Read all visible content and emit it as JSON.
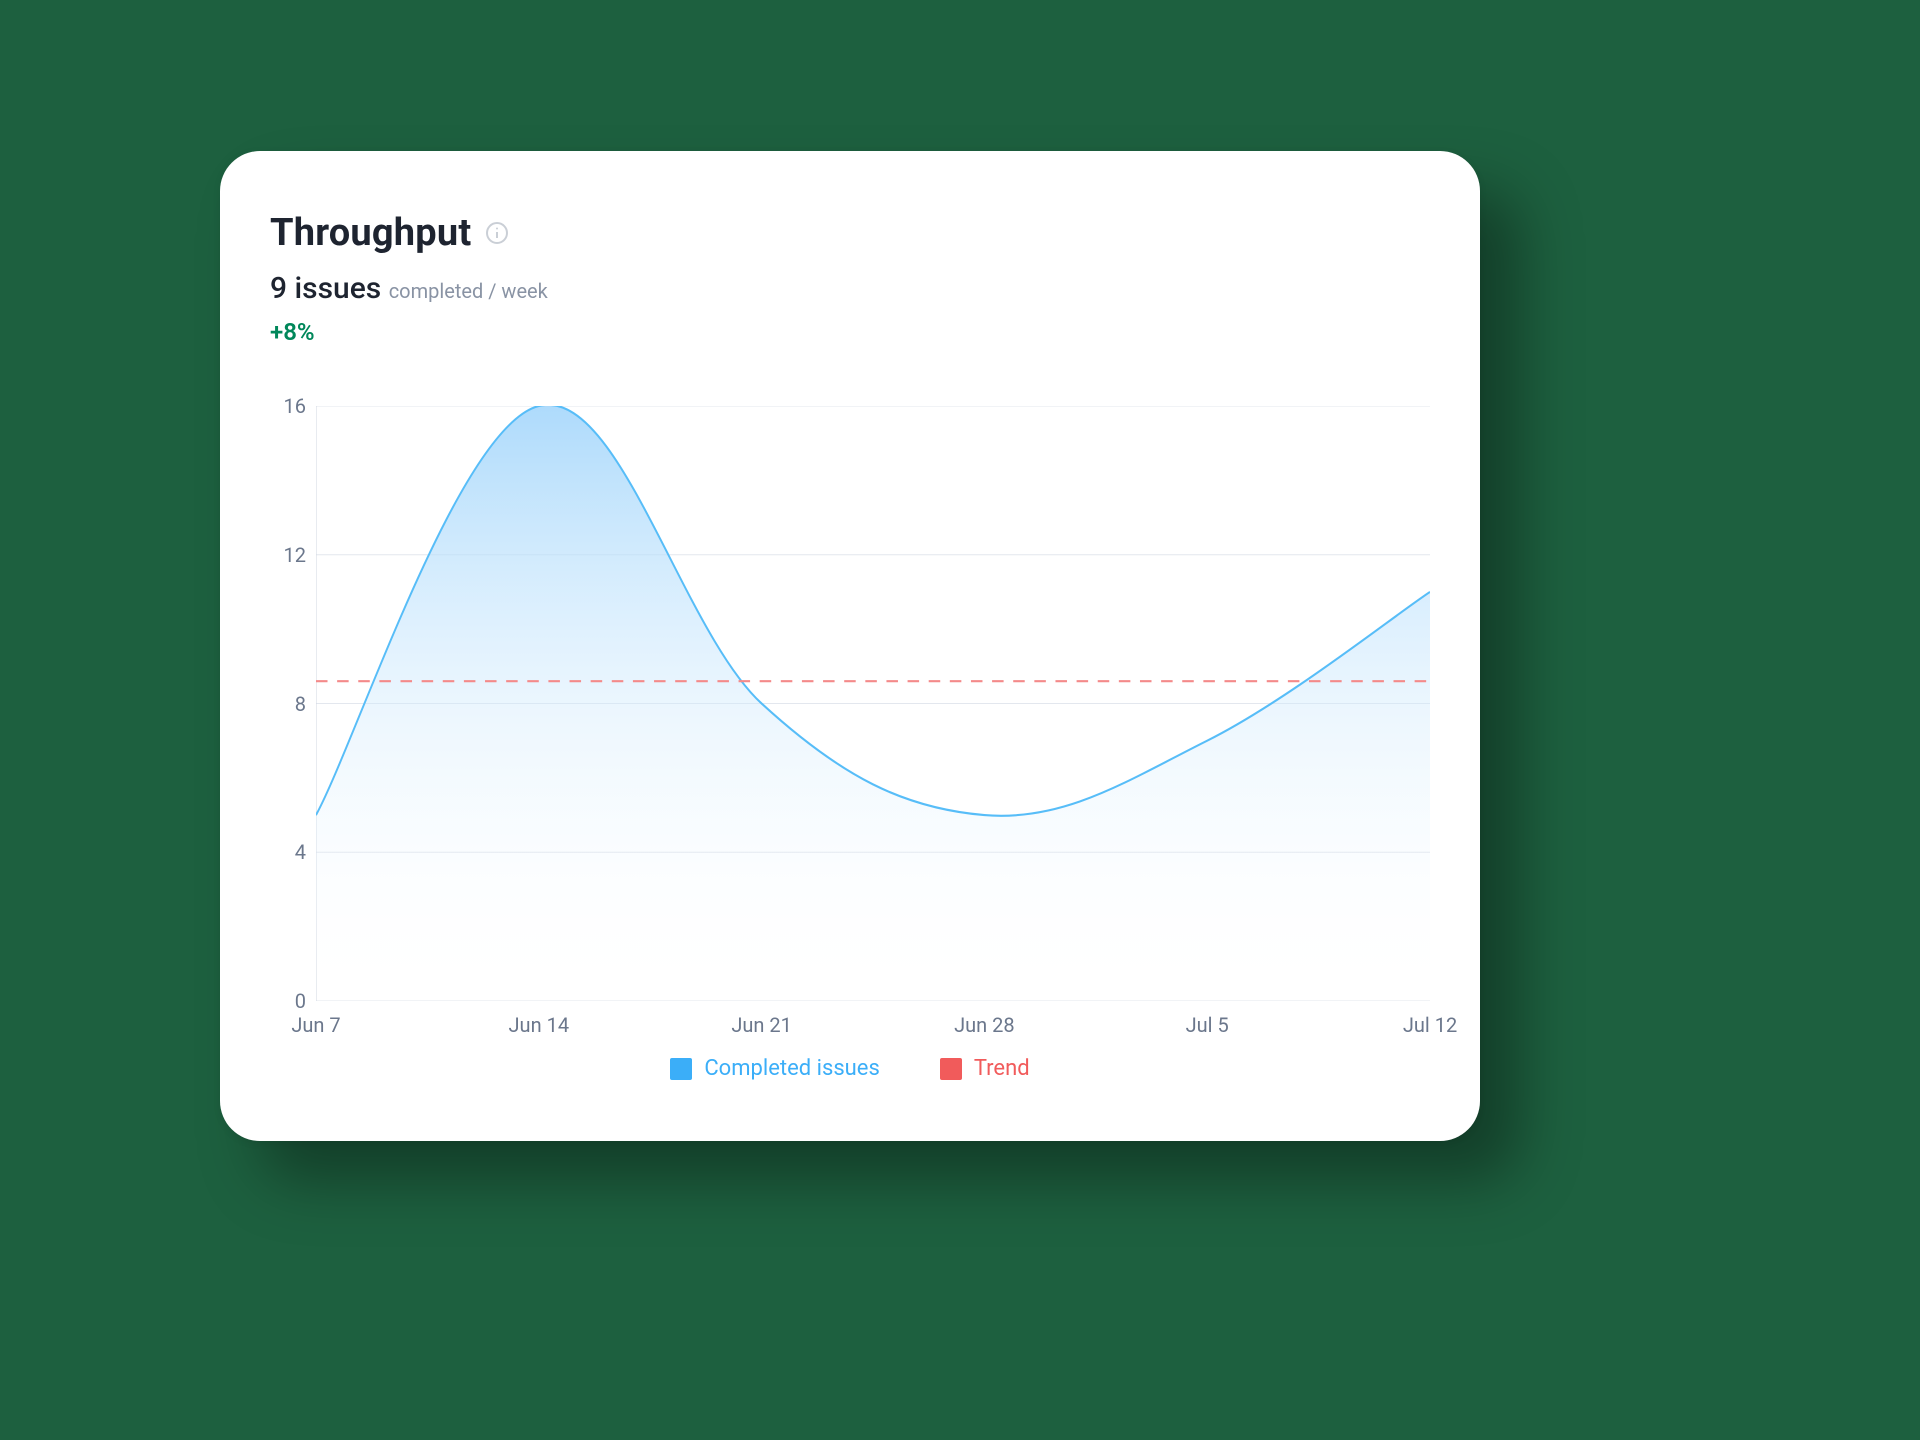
{
  "header": {
    "title": "Throughput",
    "summary_value": "9 issues",
    "summary_unit": "completed / week",
    "delta": "+8%"
  },
  "legend": {
    "completed": "Completed issues",
    "trend": "Trend"
  },
  "chart_data": {
    "type": "area",
    "categories": [
      "Jun 7",
      "Jun 14",
      "Jun 21",
      "Jun 28",
      "Jul 5",
      "Jul 12"
    ],
    "series": [
      {
        "name": "Completed issues",
        "values": [
          5,
          16,
          8,
          5,
          7,
          11
        ],
        "color": "#3baef8"
      },
      {
        "name": "Trend",
        "values": [
          8.6,
          8.6,
          8.6,
          8.6,
          8.6,
          8.6
        ],
        "color": "#f15b5b",
        "style": "dashed"
      }
    ],
    "yticks": [
      0,
      4,
      8,
      12,
      16
    ],
    "ylim": [
      0,
      16
    ],
    "xlabel": "",
    "ylabel": "",
    "title": "Throughput"
  },
  "colors": {
    "completed": "#3baef8",
    "trend": "#f15b5b",
    "positive": "#00875a"
  }
}
